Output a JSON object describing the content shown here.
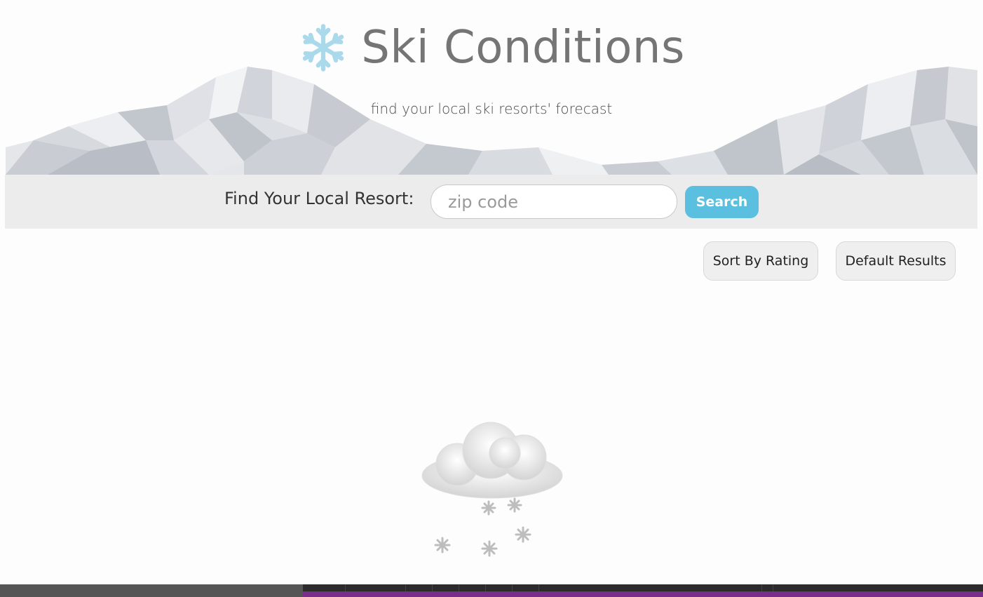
{
  "header": {
    "title": "Ski Conditions",
    "subtitle": "find your local ski resorts' forecast",
    "logo_icon": "snowflake-icon",
    "accent_color": "#a9d9ea"
  },
  "search": {
    "label": "Find Your Local Resort:",
    "placeholder": "zip code",
    "value": "",
    "button_label": "Search",
    "button_color": "#5bbfe0"
  },
  "controls": {
    "sort_label": "Sort By Rating",
    "default_label": "Default Results"
  },
  "loading": {
    "icon": "snow-cloud-icon"
  }
}
